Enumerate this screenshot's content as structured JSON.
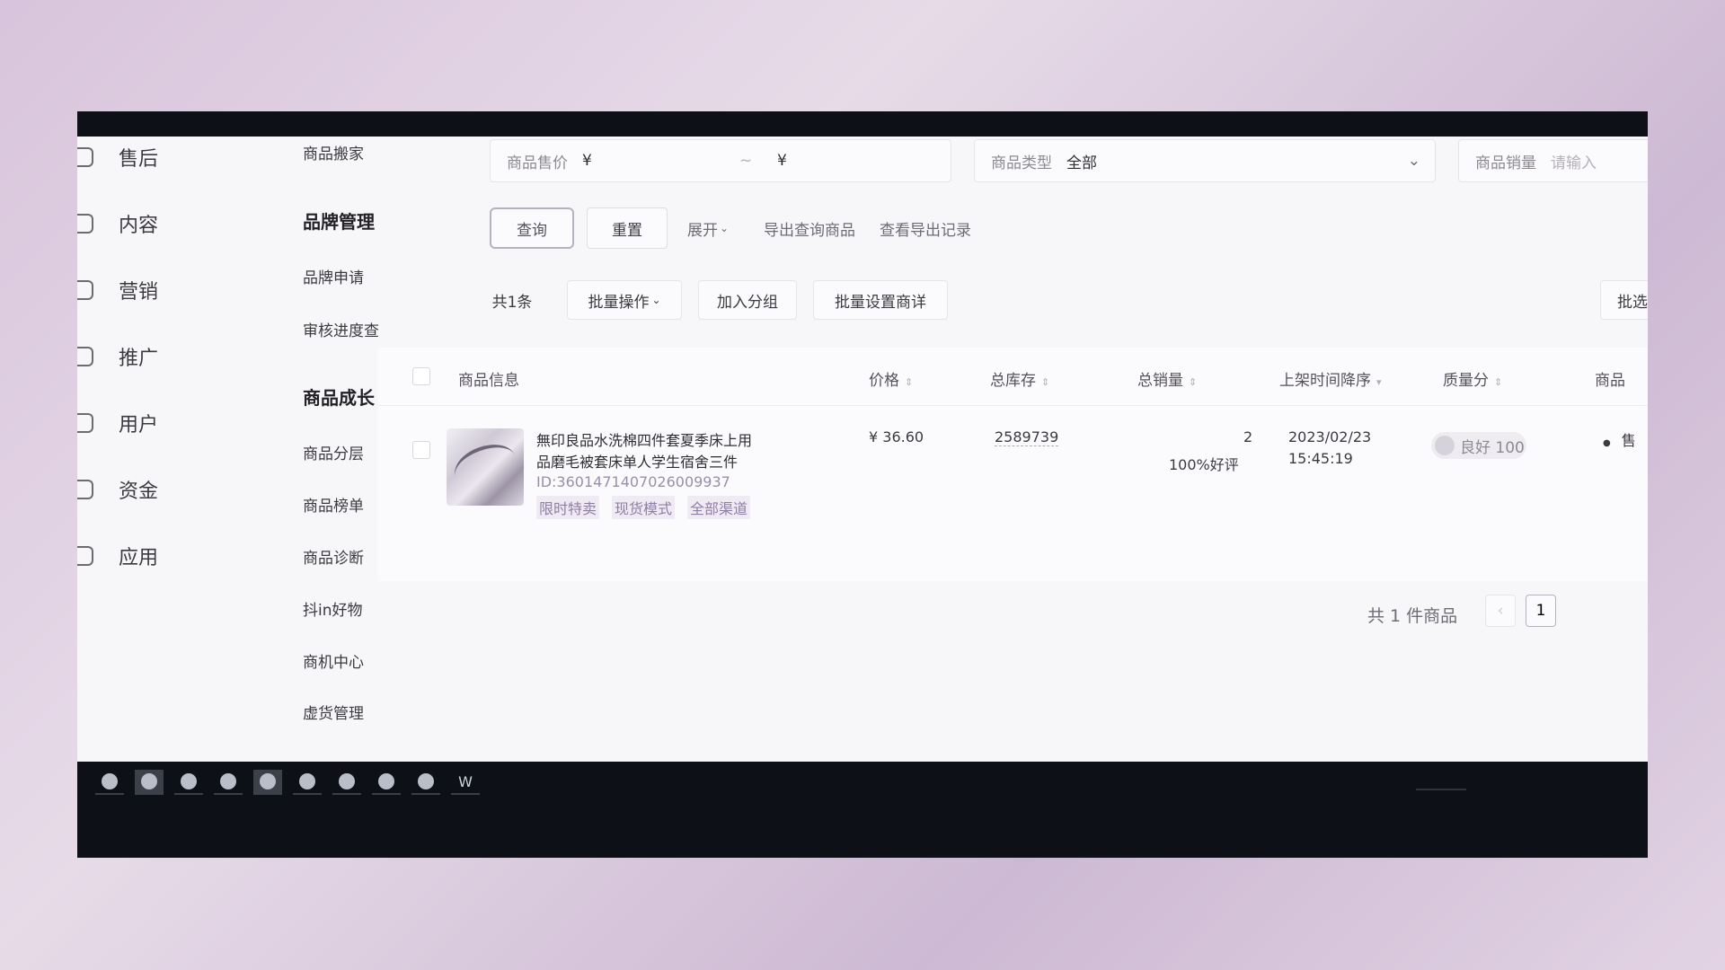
{
  "nav_main": [
    {
      "label": "售后",
      "icon": "shield-icon"
    },
    {
      "label": "内容",
      "icon": "content-icon"
    },
    {
      "label": "营销",
      "icon": "megaphone-icon"
    },
    {
      "label": "推广",
      "icon": "promotion-icon"
    },
    {
      "label": "用户",
      "icon": "user-icon"
    },
    {
      "label": "资金",
      "icon": "wallet-icon"
    },
    {
      "label": "应用",
      "icon": "app-icon"
    }
  ],
  "nav_sub": {
    "top_item": "商品搬家",
    "group1": {
      "title": "品牌管理",
      "items": [
        "品牌申请",
        "审核进度查询"
      ]
    },
    "group2": {
      "title": "商品成长",
      "items": [
        "商品分层",
        "商品榜单",
        "商品诊断",
        "抖in好物",
        "商机中心",
        "虚货管理"
      ]
    }
  },
  "filters": {
    "price": {
      "label": "商品售价",
      "min_prefix": "¥",
      "separator": "~",
      "max_prefix": "¥"
    },
    "type": {
      "label": "商品类型",
      "value": "全部"
    },
    "sales": {
      "label": "商品销量",
      "placeholder": "请输入"
    }
  },
  "actions": {
    "query": "查询",
    "reset": "重置",
    "expand": "展开",
    "export": "导出查询商品",
    "export_log": "查看导出记录"
  },
  "toolbar": {
    "count": "共1条",
    "batch": "批量操作",
    "add_group": "加入分组",
    "batch_detail": "批量设置商详",
    "right": "批选"
  },
  "table": {
    "headers": {
      "info": "商品信息",
      "price": "价格",
      "stock": "总库存",
      "sales": "总销量",
      "time": "上架时间降序",
      "quality": "质量分",
      "status": "商品"
    },
    "rows": [
      {
        "title_line1": "無印良品水洗棉四件套夏季床上用",
        "title_line2": "品磨毛被套床单人学生宿舍三件",
        "id": "ID:3601471407026009937",
        "tags": [
          "限时特卖",
          "现货模式",
          "全部渠道"
        ],
        "price": "¥ 36.60",
        "stock": "2589739",
        "sales": "2",
        "rating": "100%好评",
        "date": "2023/02/23",
        "time": "15:45:19",
        "quality": "良好 100",
        "status": "售"
      }
    ]
  },
  "pagination": {
    "total": "共 1 件商品",
    "page": "1",
    "prev": "‹"
  },
  "taskbar": [
    "app-1",
    "app-2",
    "app-3",
    "app-4",
    "app-5",
    "app-6",
    "app-7",
    "app-8",
    "app-9",
    "W"
  ]
}
